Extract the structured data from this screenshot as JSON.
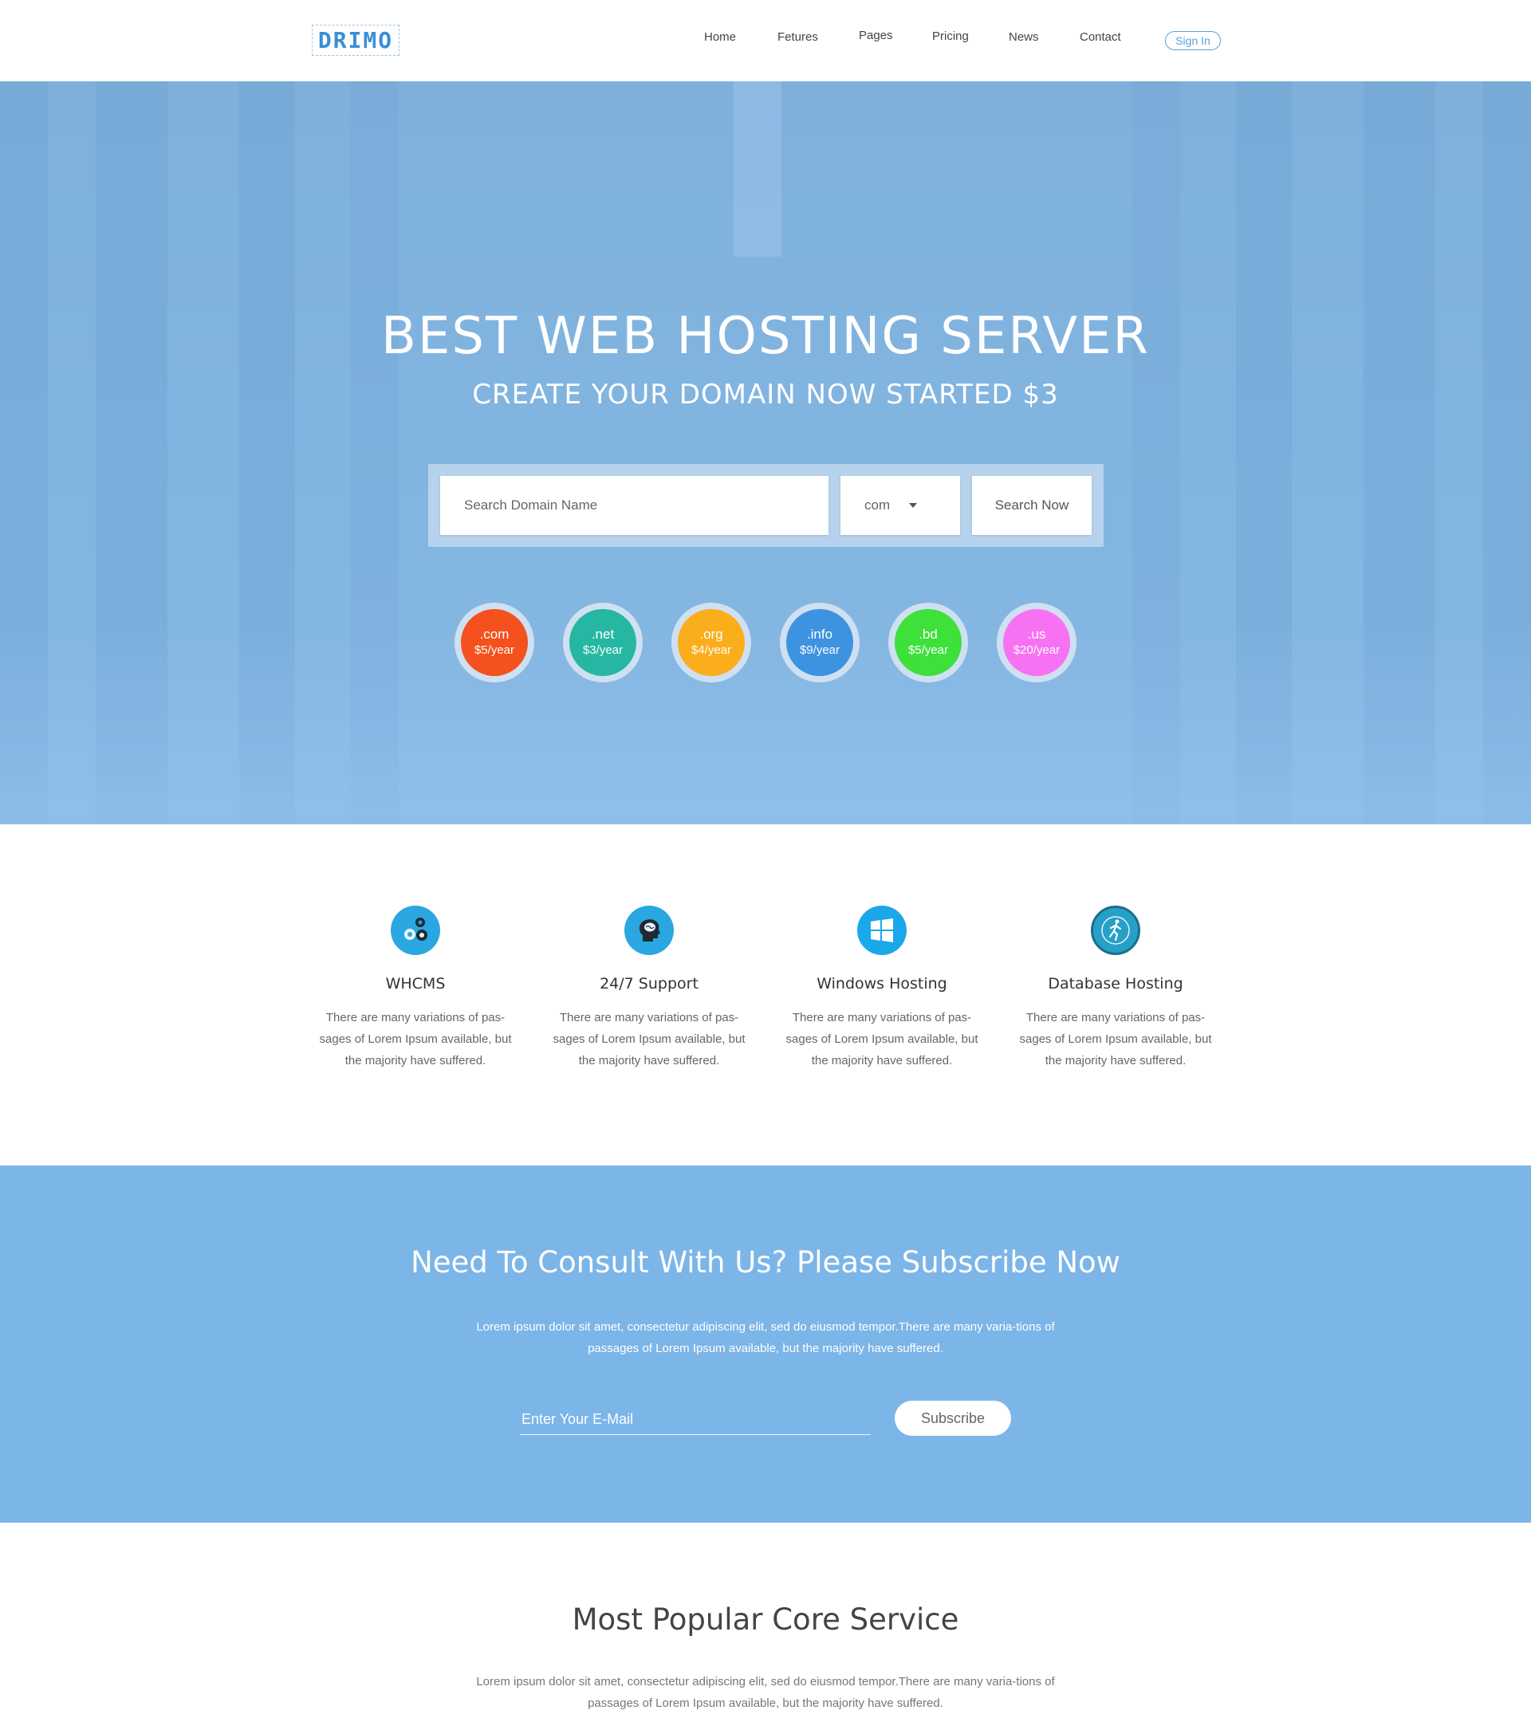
{
  "header": {
    "logo_text": "DRIMO",
    "nav": [
      {
        "label": "Home"
      },
      {
        "label": "Fetures"
      },
      {
        "label": "Pages"
      },
      {
        "label": "Pricing"
      },
      {
        "label": "News"
      },
      {
        "label": "Contact"
      }
    ],
    "signin_label": "Sign In"
  },
  "hero": {
    "title": "BEST WEB HOSTING SERVER",
    "subtitle": "CREATE YOUR DOMAIN NOW STARTED $3",
    "search_placeholder": "Search Domain Name",
    "tld_selected": "com",
    "search_button": "Search Now",
    "tlds": [
      {
        "name": ".com",
        "price": "$5/year",
        "color": "#f4511e"
      },
      {
        "name": ".net",
        "price": "$3/year",
        "color": "#26b7a2"
      },
      {
        "name": ".org",
        "price": "$4/year",
        "color": "#fbae1c"
      },
      {
        "name": ".info",
        "price": "$9/year",
        "color": "#3d93e0"
      },
      {
        "name": ".bd",
        "price": "$5/year",
        "color": "#3ee03a"
      },
      {
        "name": ".us",
        "price": "$20/year",
        "color": "#f772f2"
      }
    ]
  },
  "features": [
    {
      "icon": "gears-icon",
      "title": "WHCMS",
      "text": "There are many variations of pas-sages of Lorem Ipsum available, but the majority have suffered."
    },
    {
      "icon": "brain-head-icon",
      "title": "24/7 Support",
      "text": "There are many variations of pas-sages of Lorem Ipsum available, but the majority have suffered."
    },
    {
      "icon": "windows-icon",
      "title": "Windows Hosting",
      "text": "There are many variations of pas-sages of Lorem Ipsum available, but the majority have suffered."
    },
    {
      "icon": "runner-icon",
      "title": "Database Hosting",
      "text": "There are many variations of pas-sages of Lorem Ipsum available, but the majority have suffered."
    }
  ],
  "subscribe": {
    "title": "Need To Consult With Us? Please Subscribe Now",
    "text": "Lorem ipsum dolor sit amet, consectetur adipiscing elit, sed do eiusmod tempor.There are many varia-tions of passages of Lorem Ipsum available, but the majority have suffered.",
    "email_placeholder": "Enter Your E-Mail",
    "button": "Subscribe"
  },
  "core": {
    "title": "Most Popular Core Service",
    "text": "Lorem ipsum dolor sit amet, consectetur adipiscing elit, sed do eiusmod tempor.There are many varia-tions of passages of Lorem Ipsum available, but the majority have suffered."
  },
  "colors": {
    "accent": "#3a8fd6",
    "hero_bg": "#82b4e0",
    "subscribe_bg": "#7cb5e8"
  }
}
